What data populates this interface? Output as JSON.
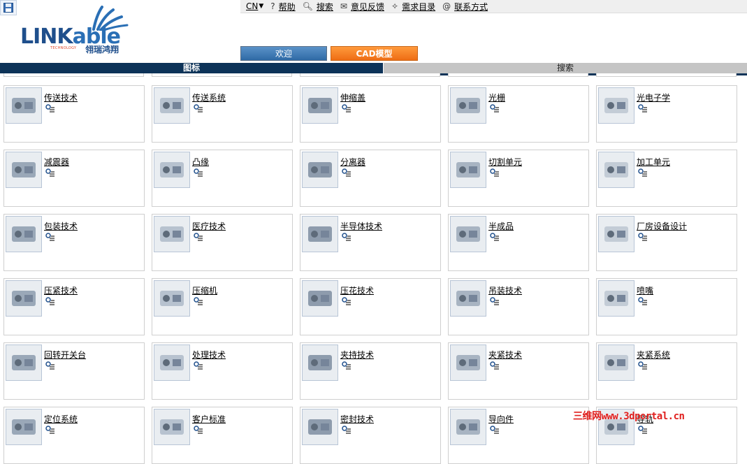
{
  "header": {
    "logo": {
      "brand_main": "LINK",
      "brand_accent": "able",
      "tagline": "TECHNOLOGY",
      "brand_cn": "翎瑞鸿翔"
    },
    "toolbar": [
      {
        "label": "CN",
        "icon": "language-dropdown-icon"
      },
      {
        "label": "帮助",
        "icon": "help-icon"
      },
      {
        "label": "搜索",
        "icon": "search-icon"
      },
      {
        "label": "意见反馈",
        "icon": "mail-icon"
      },
      {
        "label": "需求目录",
        "icon": "magic-wand-icon"
      },
      {
        "label": "联系方式",
        "icon": "contact-icon"
      }
    ],
    "tabs": [
      {
        "label": "欢迎"
      },
      {
        "label": "CAD模型"
      }
    ]
  },
  "subnav": {
    "left": "图标",
    "right": "搜索"
  },
  "categories": [
    "传送技术",
    "传送系统",
    "伸缩盖",
    "光栅",
    "光电子学",
    "减震器",
    "凸缘",
    "分离器",
    "切割单元",
    "加工单元",
    "包装技术",
    "医疗技术",
    "半导体技术",
    "半成品",
    "厂房设备设计",
    "压紧技术",
    "压缩机",
    "压花技术",
    "吊装技术",
    "喷嘴",
    "回转开关台",
    "处理技术",
    "夹持技术",
    "夹紧技术",
    "夹紧系统",
    "定位系统",
    "客户标准",
    "密封技术",
    "导向件",
    "导轨"
  ],
  "watermark": "三维网www.3dportal.cn",
  "colors": {
    "nav_dark": "#0d3358",
    "tab_blue": "#2f6aa6",
    "tab_orange": "#ee6d14",
    "watermark": "#e0201e"
  }
}
